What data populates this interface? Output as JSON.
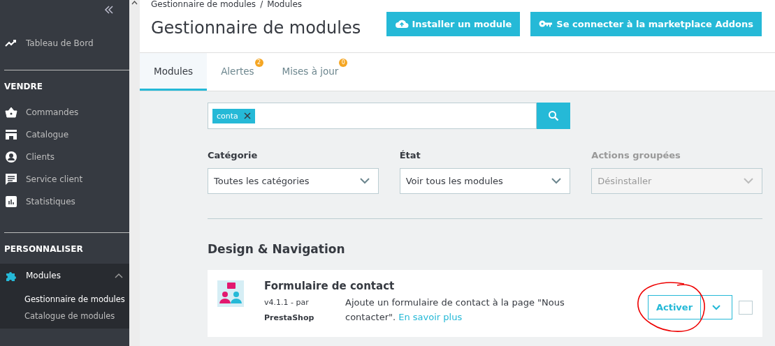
{
  "sidebar": {
    "top_item": {
      "label": "Tableau de Bord"
    },
    "sections": [
      {
        "title": "VENDRE",
        "items": [
          {
            "label": "Commandes",
            "expanded": false
          },
          {
            "label": "Catalogue",
            "expanded": false
          },
          {
            "label": "Clients",
            "expanded": false
          },
          {
            "label": "Service client",
            "expanded": false
          },
          {
            "label": "Statistiques",
            "expanded": false
          }
        ]
      },
      {
        "title": "PERSONNALISER",
        "items": [
          {
            "label": "Modules",
            "expanded": true,
            "children": [
              {
                "label": "Gestionnaire de modules",
                "selected": true
              },
              {
                "label": "Catalogue de modules",
                "selected": false
              }
            ]
          }
        ]
      }
    ]
  },
  "header": {
    "breadcrumb": [
      "Gestionnaire de modules",
      "Modules"
    ],
    "separator": "/",
    "title": "Gestionnaire de modules",
    "buttons": [
      {
        "label": "Installer un module"
      },
      {
        "label": "Se connecter à la marketplace Addons"
      }
    ]
  },
  "tabs": [
    {
      "label": "Modules",
      "selected": true
    },
    {
      "label": "Alertes",
      "selected": false,
      "badge": "2"
    },
    {
      "label": "Mises à jour",
      "selected": false,
      "badge": "0"
    }
  ],
  "search": {
    "tags": [
      {
        "label": "conta"
      }
    ]
  },
  "filters": [
    {
      "label": "Catégorie",
      "value": "Toutes les catégories",
      "disabled": false
    },
    {
      "label": "État",
      "value": "Voir tous les modules",
      "disabled": false
    },
    {
      "label": "Actions groupées",
      "value": "Désinstaller",
      "disabled": true
    }
  ],
  "section_title": "Design & Navigation",
  "modules": [
    {
      "name": "Formulaire de contact",
      "version": "v4.1.1 - par",
      "author": "PrestaShop",
      "description": "Ajoute un formulaire de contact à la page \"Nous contacter\".",
      "link": "En savoir plus",
      "action": "Activer",
      "checked": false
    }
  ]
}
